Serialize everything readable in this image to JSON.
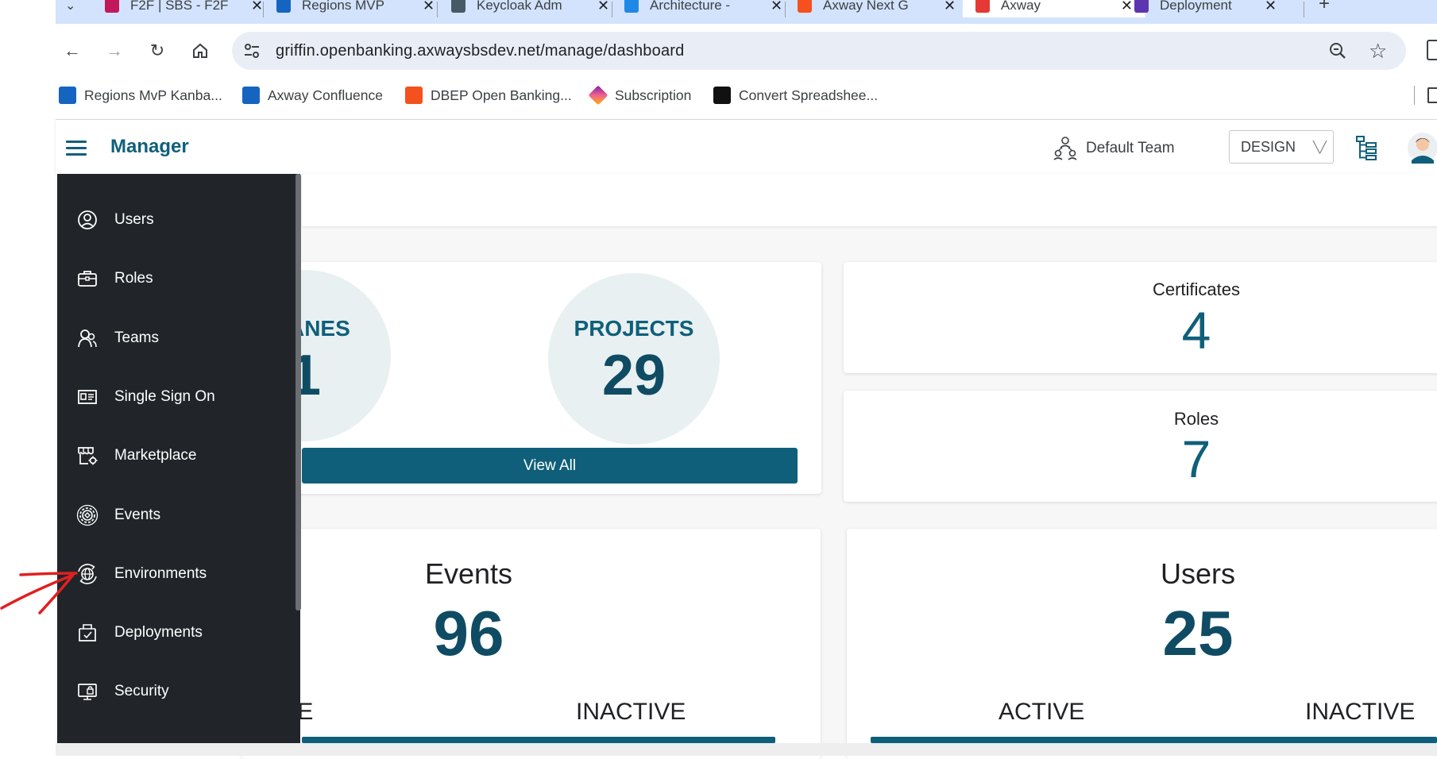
{
  "browser": {
    "tabs": [
      {
        "title": "F2F | SBS - F2F",
        "favicon_color": "#c2185b"
      },
      {
        "title": "Regions MVP",
        "favicon_color": "#1565c0"
      },
      {
        "title": "Keycloak Adm",
        "favicon_color": "#455a64"
      },
      {
        "title": "Architecture -",
        "favicon_color": "#1e88e5"
      },
      {
        "title": "Axway Next G",
        "favicon_color": "#f4511e"
      },
      {
        "title": "Axway",
        "favicon_color": "#e53935",
        "active": true
      },
      {
        "title": "Deployment",
        "favicon_color": "#5e35b1"
      }
    ],
    "url": "griffin.openbanking.axwaysbsdev.net/manage/dashboard",
    "bookmarks": [
      {
        "label": "Regions MvP Kanba...",
        "icon_color": "#1565c0"
      },
      {
        "label": "Axway Confluence",
        "icon_color": "#1565c0"
      },
      {
        "label": "DBEP Open Banking...",
        "icon_color": "#f4511e"
      },
      {
        "label": "Subscription",
        "icon_color": "#c2185b"
      },
      {
        "label": "Convert Spreadshee...",
        "icon_color": "#111111"
      }
    ]
  },
  "app": {
    "title": "Manager",
    "team": "Default Team",
    "mode": "DESIGN",
    "accent_color": "#0f5f7a"
  },
  "sidebar": {
    "items": [
      {
        "label": "Users",
        "icon": "user-circle-icon"
      },
      {
        "label": "Roles",
        "icon": "briefcase-icon"
      },
      {
        "label": "Teams",
        "icon": "team-icon"
      },
      {
        "label": "Single Sign On",
        "icon": "id-card-icon"
      },
      {
        "label": "Marketplace",
        "icon": "storefront-icon"
      },
      {
        "label": "Events",
        "icon": "gear-events-icon"
      },
      {
        "label": "Environments",
        "icon": "globe-cycle-icon"
      },
      {
        "label": "Deployments",
        "icon": "deploy-box-icon"
      },
      {
        "label": "Security",
        "icon": "security-screen-icon"
      }
    ]
  },
  "dashboard": {
    "planes_label": "PLANES",
    "planes_value": "1",
    "projects_label": "PROJECTS",
    "projects_value": "29",
    "view_all_label": "View All",
    "certificates_label": "Certificates",
    "certificates_value": "4",
    "roles_label": "Roles",
    "roles_value": "7",
    "events_title": "Events",
    "events_value": "96",
    "events_active_label": "ACTIVE",
    "events_inactive_label": "INACTIVE",
    "users_title": "Users",
    "users_value": "25",
    "users_active_label": "ACTIVE",
    "users_inactive_label": "INACTIVE"
  },
  "annotation": {
    "arrow_color": "#e02020",
    "points_to": "Environments"
  }
}
